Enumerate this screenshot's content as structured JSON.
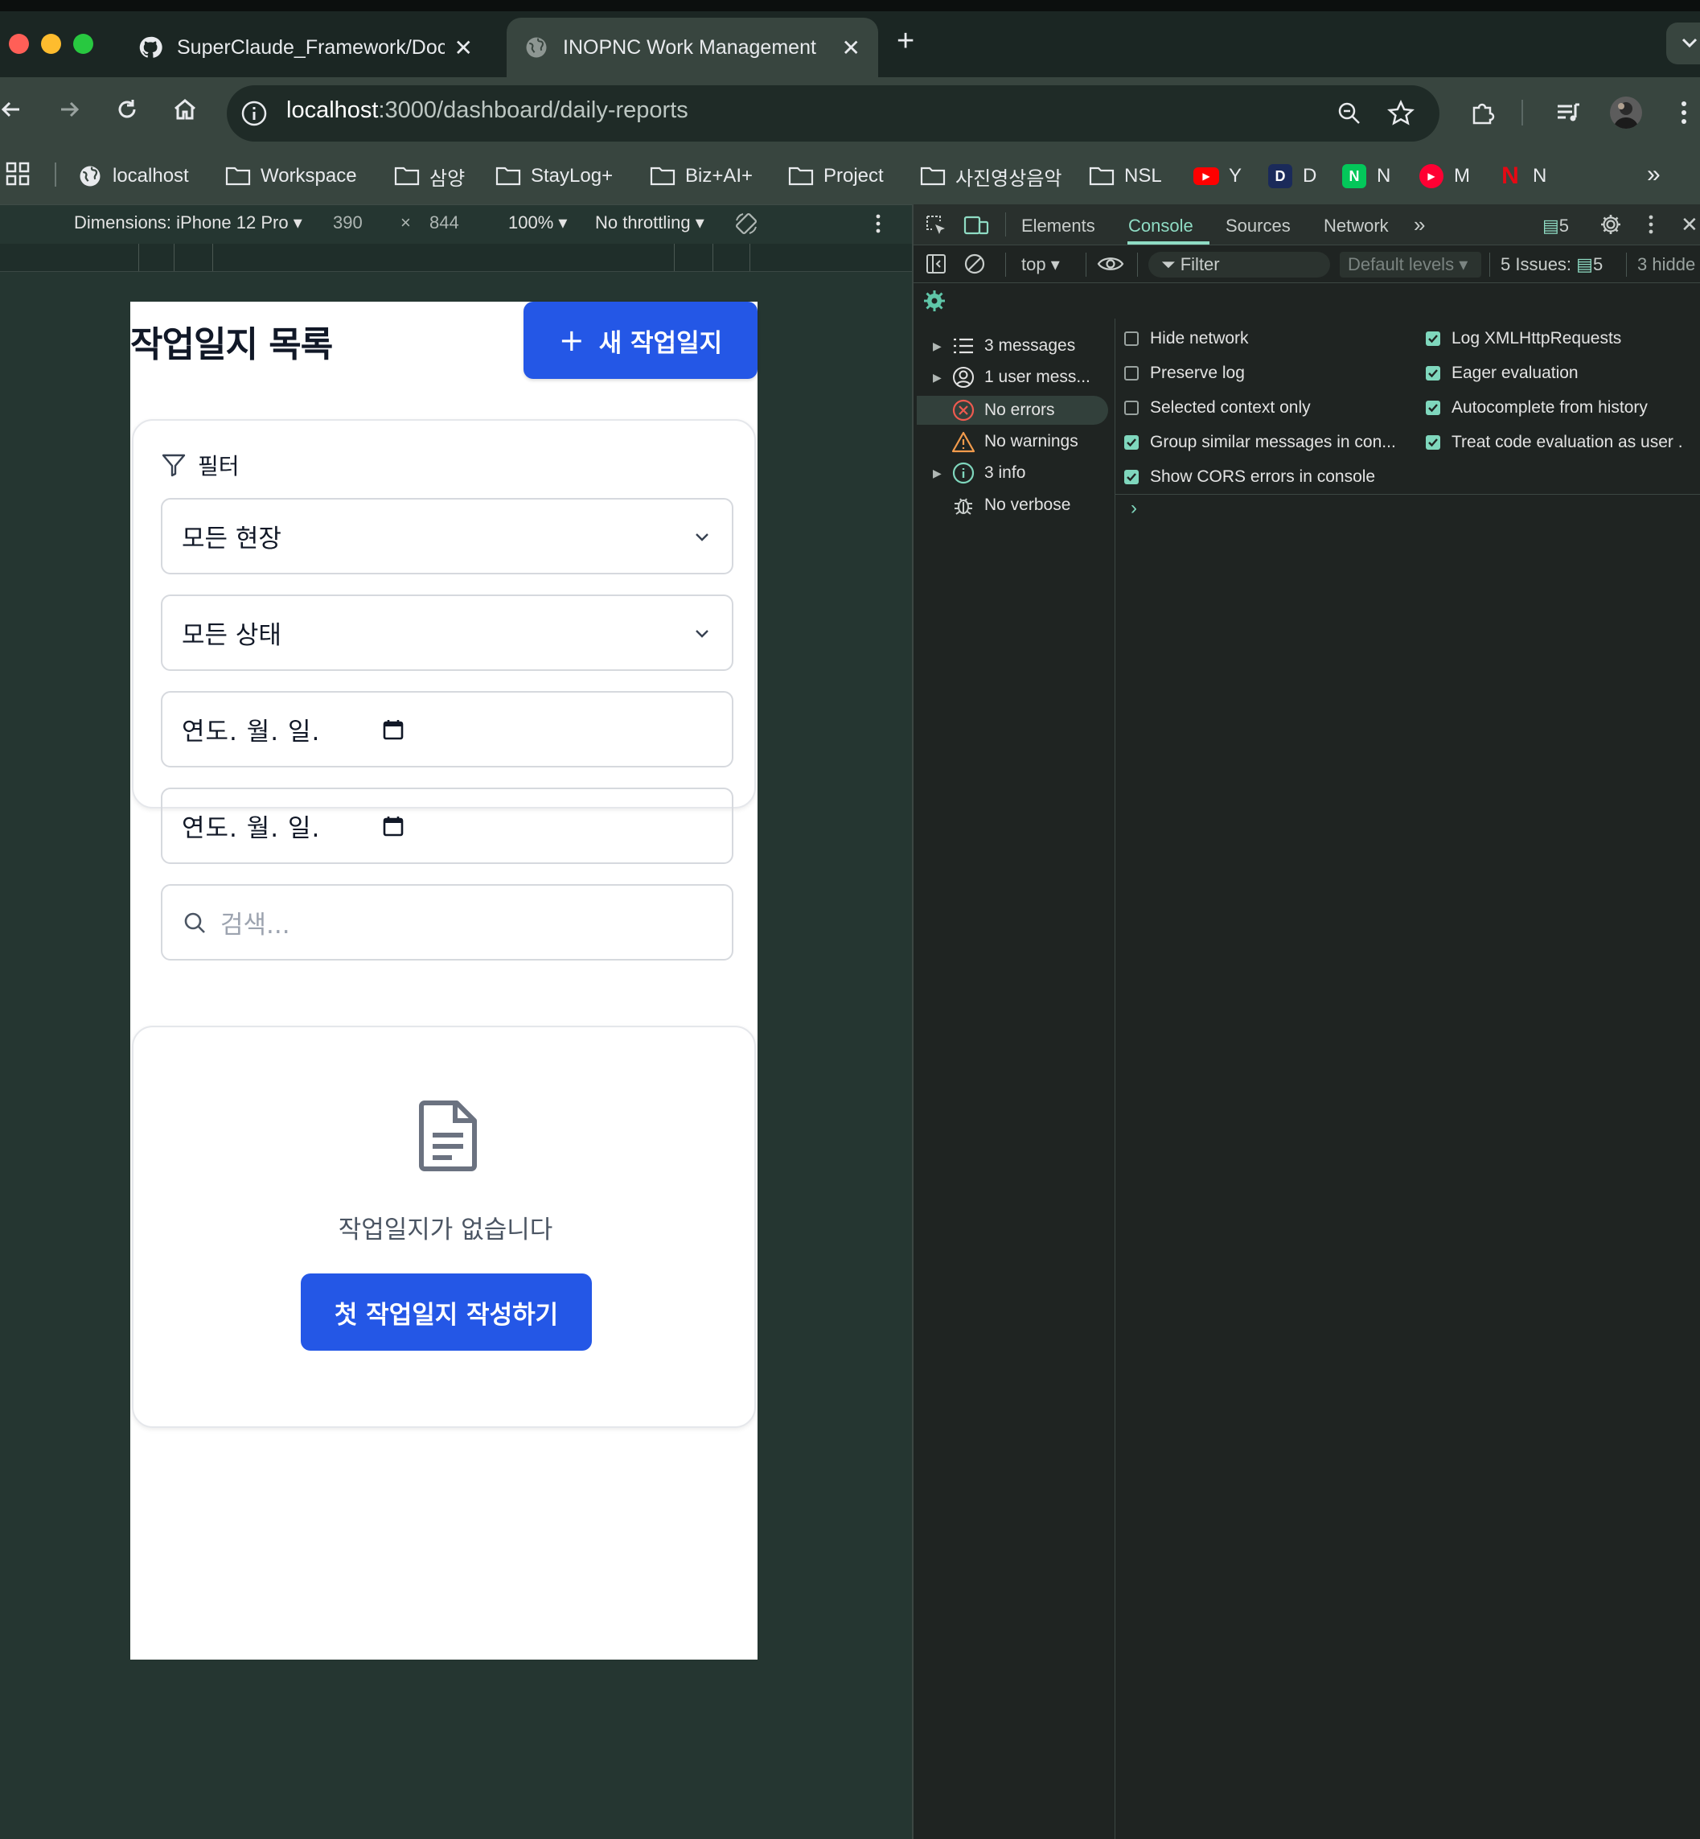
{
  "browser": {
    "tabs": [
      {
        "title": "SuperClaude_Framework/Doc",
        "icon": "github-icon",
        "active": false
      },
      {
        "title": "INOPNC Work Management",
        "icon": "globe-icon",
        "active": true
      }
    ],
    "url_host": "localhost",
    "url_path": ":3000/dashboard/daily-reports",
    "bookmarks": [
      {
        "label": "localhost",
        "icon": "globe-icon"
      },
      {
        "label": "Workspace",
        "icon": "folder-icon"
      },
      {
        "label": "삼양",
        "icon": "folder-icon"
      },
      {
        "label": "StayLog+",
        "icon": "folder-icon"
      },
      {
        "label": "Biz+AI+",
        "icon": "folder-icon"
      },
      {
        "label": "Project",
        "icon": "folder-icon"
      },
      {
        "label": "사진영상음악",
        "icon": "folder-icon"
      },
      {
        "label": "NSL",
        "icon": "folder-icon"
      },
      {
        "label": "Y",
        "icon": "youtube-icon"
      },
      {
        "label": "D",
        "icon": "d-icon"
      },
      {
        "label": "N",
        "icon": "naver-icon"
      },
      {
        "label": "M",
        "icon": "music-icon"
      },
      {
        "label": "N",
        "icon": "netflix-icon"
      }
    ]
  },
  "device_toolbar": {
    "dimensions": "Dimensions: iPhone 12 Pro",
    "width": "390",
    "height": "844",
    "times": "×",
    "zoom": "100%",
    "throttling": "No throttling"
  },
  "app": {
    "page_title": "작업일지 목록",
    "new_button": "새 작업일지",
    "filter_title": "필터",
    "site_select": "모든 현장",
    "status_select": "모든 상태",
    "date_from_placeholder": "연도. 월. 일.",
    "date_to_placeholder": "연도. 월. 일.",
    "search_placeholder": "검색...",
    "empty_text": "작업일지가 없습니다",
    "first_button": "첫 작업일지 작성하기",
    "accent_color": "#2457e6"
  },
  "devtools": {
    "tabs": [
      "Elements",
      "Console",
      "Sources",
      "Network"
    ],
    "issue_badge": "5",
    "context": "top",
    "filter_placeholder": "Filter",
    "levels": "Default levels",
    "issues_label": "5 Issues:",
    "issues_count": "5",
    "hidden_label": "3 hidde",
    "sidebar": [
      {
        "label": "3 messages",
        "icon": "list-icon",
        "expandable": true
      },
      {
        "label": "1 user mess...",
        "icon": "user-icon",
        "expandable": true
      },
      {
        "label": "No errors",
        "icon": "error-icon",
        "expandable": false,
        "selected": true
      },
      {
        "label": "No warnings",
        "icon": "warning-icon",
        "expandable": false
      },
      {
        "label": "3 info",
        "icon": "info-icon",
        "expandable": true
      },
      {
        "label": "No verbose",
        "icon": "bug-icon",
        "expandable": false
      }
    ],
    "options_left": [
      {
        "label": "Hide network",
        "checked": false
      },
      {
        "label": "Preserve log",
        "checked": false
      },
      {
        "label": "Selected context only",
        "checked": false
      },
      {
        "label": "Group similar messages in con...",
        "checked": true
      },
      {
        "label": "Show CORS errors in console",
        "checked": true
      }
    ],
    "options_right": [
      {
        "label": "Log XMLHttpRequests",
        "checked": true
      },
      {
        "label": "Eager evaluation",
        "checked": true
      },
      {
        "label": "Autocomplete from history",
        "checked": true
      },
      {
        "label": "Treat code evaluation as user .",
        "checked": true
      }
    ],
    "prompt": "›"
  }
}
